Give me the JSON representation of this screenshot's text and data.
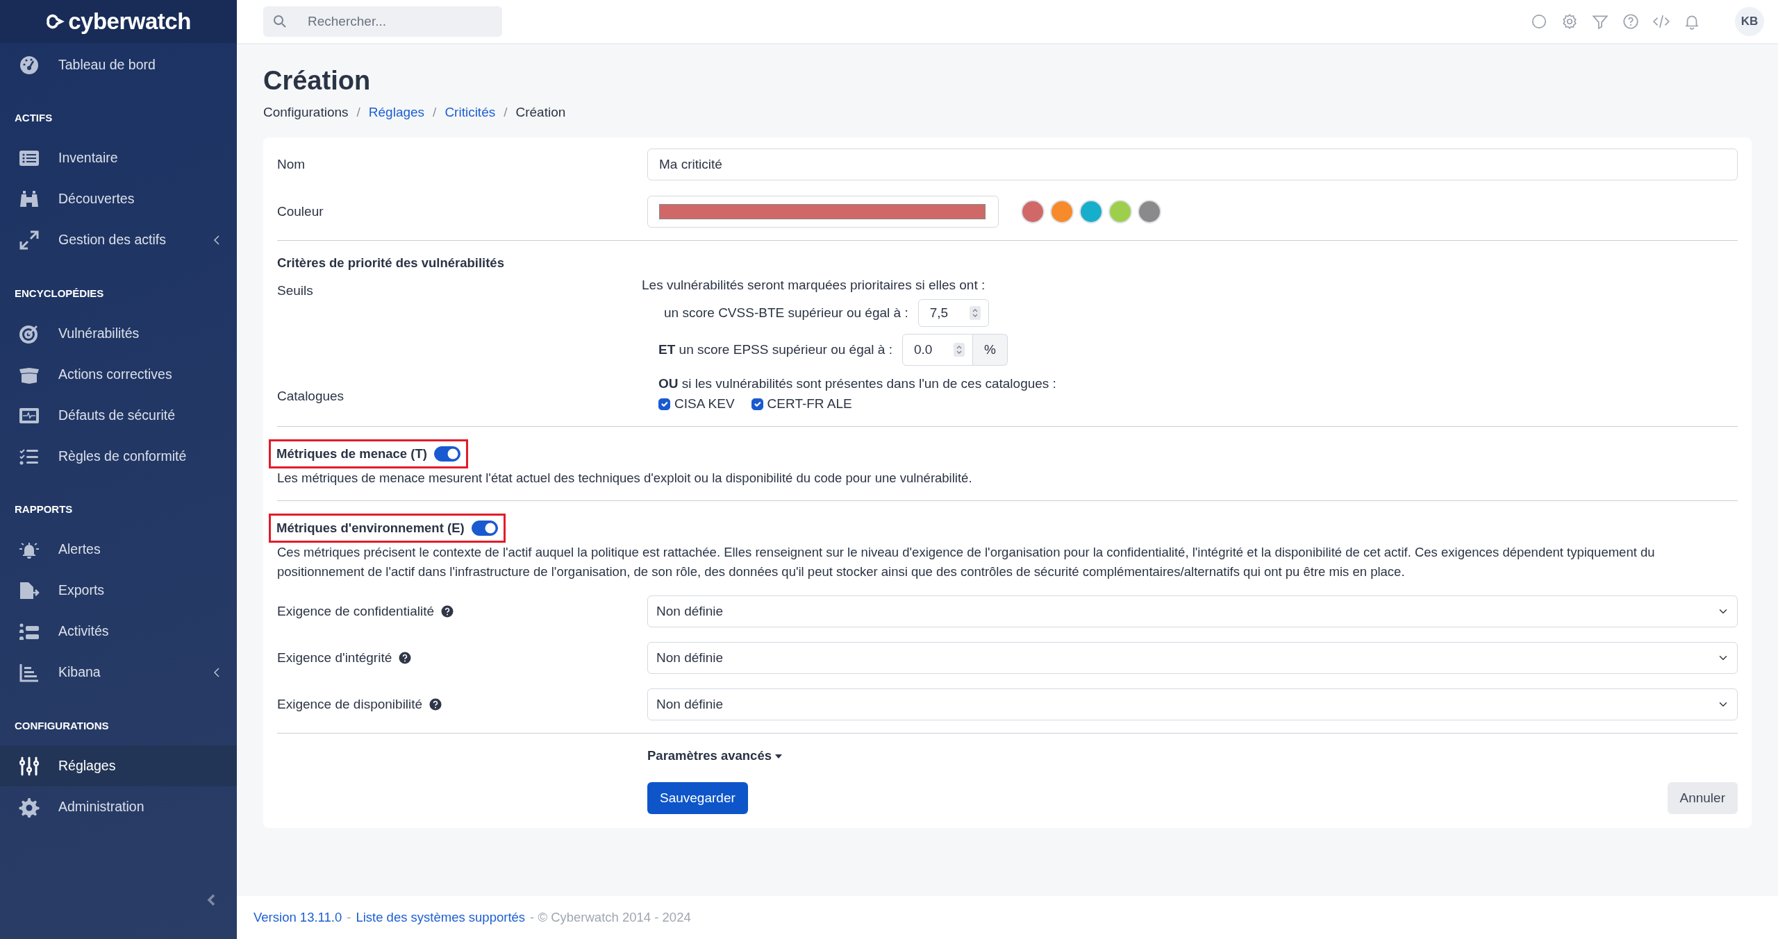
{
  "logo": "cyberwatch",
  "sidebar": {
    "sections": [
      {
        "items": [
          {
            "label": "Tableau de bord",
            "selected": false,
            "expandable": false
          }
        ]
      },
      {
        "heading": "ACTIFS",
        "items": [
          {
            "label": "Inventaire",
            "selected": false,
            "expandable": false
          },
          {
            "label": "Découvertes",
            "selected": false,
            "expandable": false
          },
          {
            "label": "Gestion des actifs",
            "selected": false,
            "expandable": true
          }
        ]
      },
      {
        "heading": "ENCYCLOPÉDIES",
        "items": [
          {
            "label": "Vulnérabilités",
            "selected": false,
            "expandable": false
          },
          {
            "label": "Actions correctives",
            "selected": false,
            "expandable": false
          },
          {
            "label": "Défauts de sécurité",
            "selected": false,
            "expandable": false
          },
          {
            "label": "Règles de conformité",
            "selected": false,
            "expandable": false
          }
        ]
      },
      {
        "heading": "RAPPORTS",
        "items": [
          {
            "label": "Alertes",
            "selected": false,
            "expandable": false
          },
          {
            "label": "Exports",
            "selected": false,
            "expandable": false
          },
          {
            "label": "Activités",
            "selected": false,
            "expandable": false
          },
          {
            "label": "Kibana",
            "selected": false,
            "expandable": true
          }
        ]
      },
      {
        "heading": "CONFIGURATIONS",
        "items": [
          {
            "label": "Réglages",
            "selected": true,
            "expandable": false
          },
          {
            "label": "Administration",
            "selected": false,
            "expandable": false
          }
        ]
      }
    ]
  },
  "topbar": {
    "search": {
      "placeholder": "Rechercher..."
    },
    "avatar": "KB"
  },
  "page": {
    "title": "Création",
    "breadcrumb": [
      {
        "label": "Configurations",
        "link": false
      },
      {
        "label": "Réglages",
        "link": true
      },
      {
        "label": "Criticités",
        "link": true
      },
      {
        "label": "Création",
        "link": false
      }
    ],
    "breadcrumb_separator": "/"
  },
  "form": {
    "name": {
      "label": "Nom",
      "value": "Ma criticité"
    },
    "color": {
      "label": "Couleur",
      "color": "#d16868",
      "swatches": [
        {
          "color": "#d16868"
        },
        {
          "color": "#f78a2a"
        },
        {
          "color": "#17aecb"
        },
        {
          "color": "#9ecf4c"
        },
        {
          "color": "#8a8a8a"
        }
      ]
    },
    "criteria": {
      "title": "Critères de priorité des vulnérabilités",
      "thresholds_label": "Seuils",
      "intro": "Les vulnérabilités seront marquées prioritaires si elles ont :",
      "cvss": {
        "label": "un score CVSS-BTE supérieur ou égal à :",
        "value": "7,5"
      },
      "epss": {
        "label": "**ET** un score EPSS supérieur ou égal à :",
        "value": "0.0",
        "unit": "%"
      },
      "catalogues_label": "Catalogues",
      "catalogues_text": "**OU** si les vulnérabilités sont présentes dans l'un de ces catalogues :",
      "catalogues": [
        {
          "label": "CISA KEV",
          "checked": true
        },
        {
          "label": "CERT-FR ALE",
          "checked": true
        }
      ]
    },
    "threat": {
      "title": "Métriques de menace (T)",
      "on": true,
      "highlighted": true,
      "description": "Les métriques de menace mesurent l'état actuel des techniques d'exploit ou la disponibilité du code pour une vulnérabilité."
    },
    "environment": {
      "title": "Métriques d'environnement (E)",
      "on": true,
      "highlighted": true,
      "description": "Ces métriques précisent le contexte de l'actif auquel la politique est rattachée. Elles renseignent sur le niveau d'exigence de l'organisation pour la confidentialité, l'intégrité et la disponibilité de cet actif. Ces exigences dépendent typiquement du positionnement de l'actif dans l'infrastructure de l'organisation, de son rôle, des données qu'il peut stocker ainsi que des contrôles de sécurité complémentaires/alternatifs qui ont pu être mis en place.",
      "requirements": [
        {
          "label": "Exigence de confidentialité",
          "value": "Non définie"
        },
        {
          "label": "Exigence d'intégrité",
          "value": "Non définie"
        },
        {
          "label": "Exigence de disponibilité",
          "value": "Non définie"
        }
      ]
    },
    "advanced": "Paramètres avancés",
    "save": "Sauvegarder",
    "cancel": "Annuler"
  },
  "footer": {
    "version": "Version 13.11.0",
    "sep": "-",
    "systems": "Liste des systèmes supportés",
    "copyright": "- © Cyberwatch 2014 - 2024"
  }
}
